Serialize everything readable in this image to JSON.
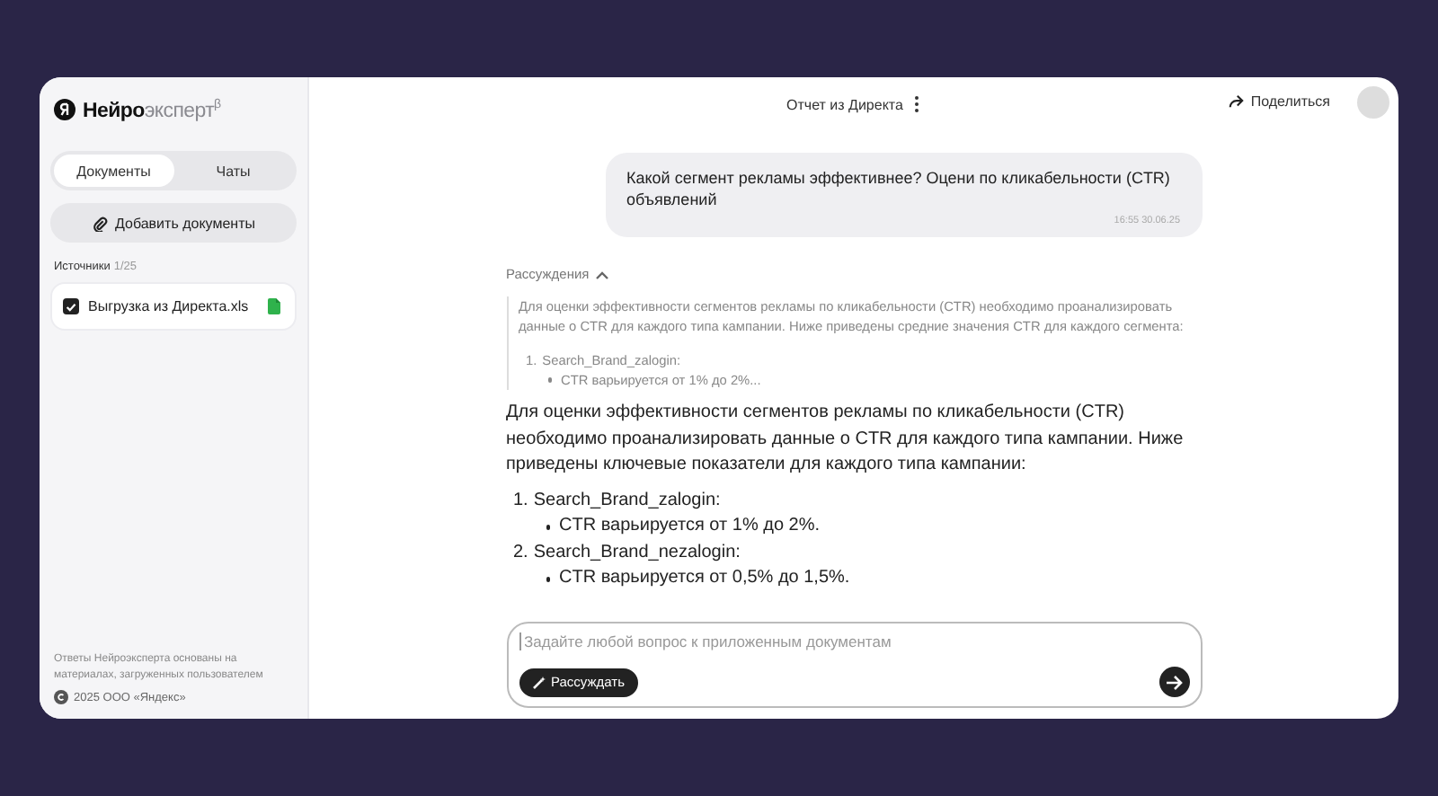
{
  "sidebar": {
    "logo": "**Нейро**эксперт$^{β}$",
    "tabs": [
      {
        "label": "Документы",
        "selected": true
      },
      {
        "label": "Чаты",
        "selected": false
      }
    ],
    "add_button": "Добавить документы",
    "sources_label": "Источники",
    "sources_count": "1/25",
    "documents": [
      {
        "name": "Выгрузка из Директа.xls",
        "checked": true
      }
    ],
    "disclaimer": "Ответы Нейроэксперта основаны на материалах, загруженных пользователем",
    "copyright": "2025 ООО «Яндекс»"
  },
  "header": {
    "title": "Отчет из Директа",
    "share": "Поделиться"
  },
  "chat": {
    "question": {
      "text": "Какой сегмент рекламы эффективнее? Оцени по кликабельности (CTR) объявлений",
      "time": "16:55 30.06.25"
    },
    "reasoning": {
      "label": "Рассуждения",
      "expanded": true,
      "paragraph": "Для оценки эффективности сегментов рекламы по кликабельности (CTR) необходимо проанализировать данные о CTR для каждого типа кампании. Ниже приведены средние значения CTR для каждого сегмента:",
      "items": [
        {
          "number": "1.",
          "title": "Search_Brand_zalogin:",
          "bullets": [
            "CTR варьируется от 1% до 2%..."
          ]
        }
      ]
    },
    "answer": {
      "paragraph": "Для оценки эффективности сегментов рекламы по кликабельности (CTR) необходимо проанализировать данные о CTR для каждого типа кампании. Ниже приведены ключевые показатели для каждого типа кампании:",
      "items": [
        {
          "number": "1.",
          "title": "Search_Brand_zalogin:",
          "bullets": [
            "CTR варьируется от 1% до 2%."
          ]
        },
        {
          "number": "2.",
          "title": "Search_Brand_nezalogin:",
          "bullets": [
            "CTR варьируется от 0,5% до 1,5%."
          ]
        }
      ]
    }
  },
  "composer": {
    "placeholder": "Задайте любой вопрос к приложенным документам",
    "think_button": {
      "label": "Рассуждать",
      "selected": true
    }
  }
}
